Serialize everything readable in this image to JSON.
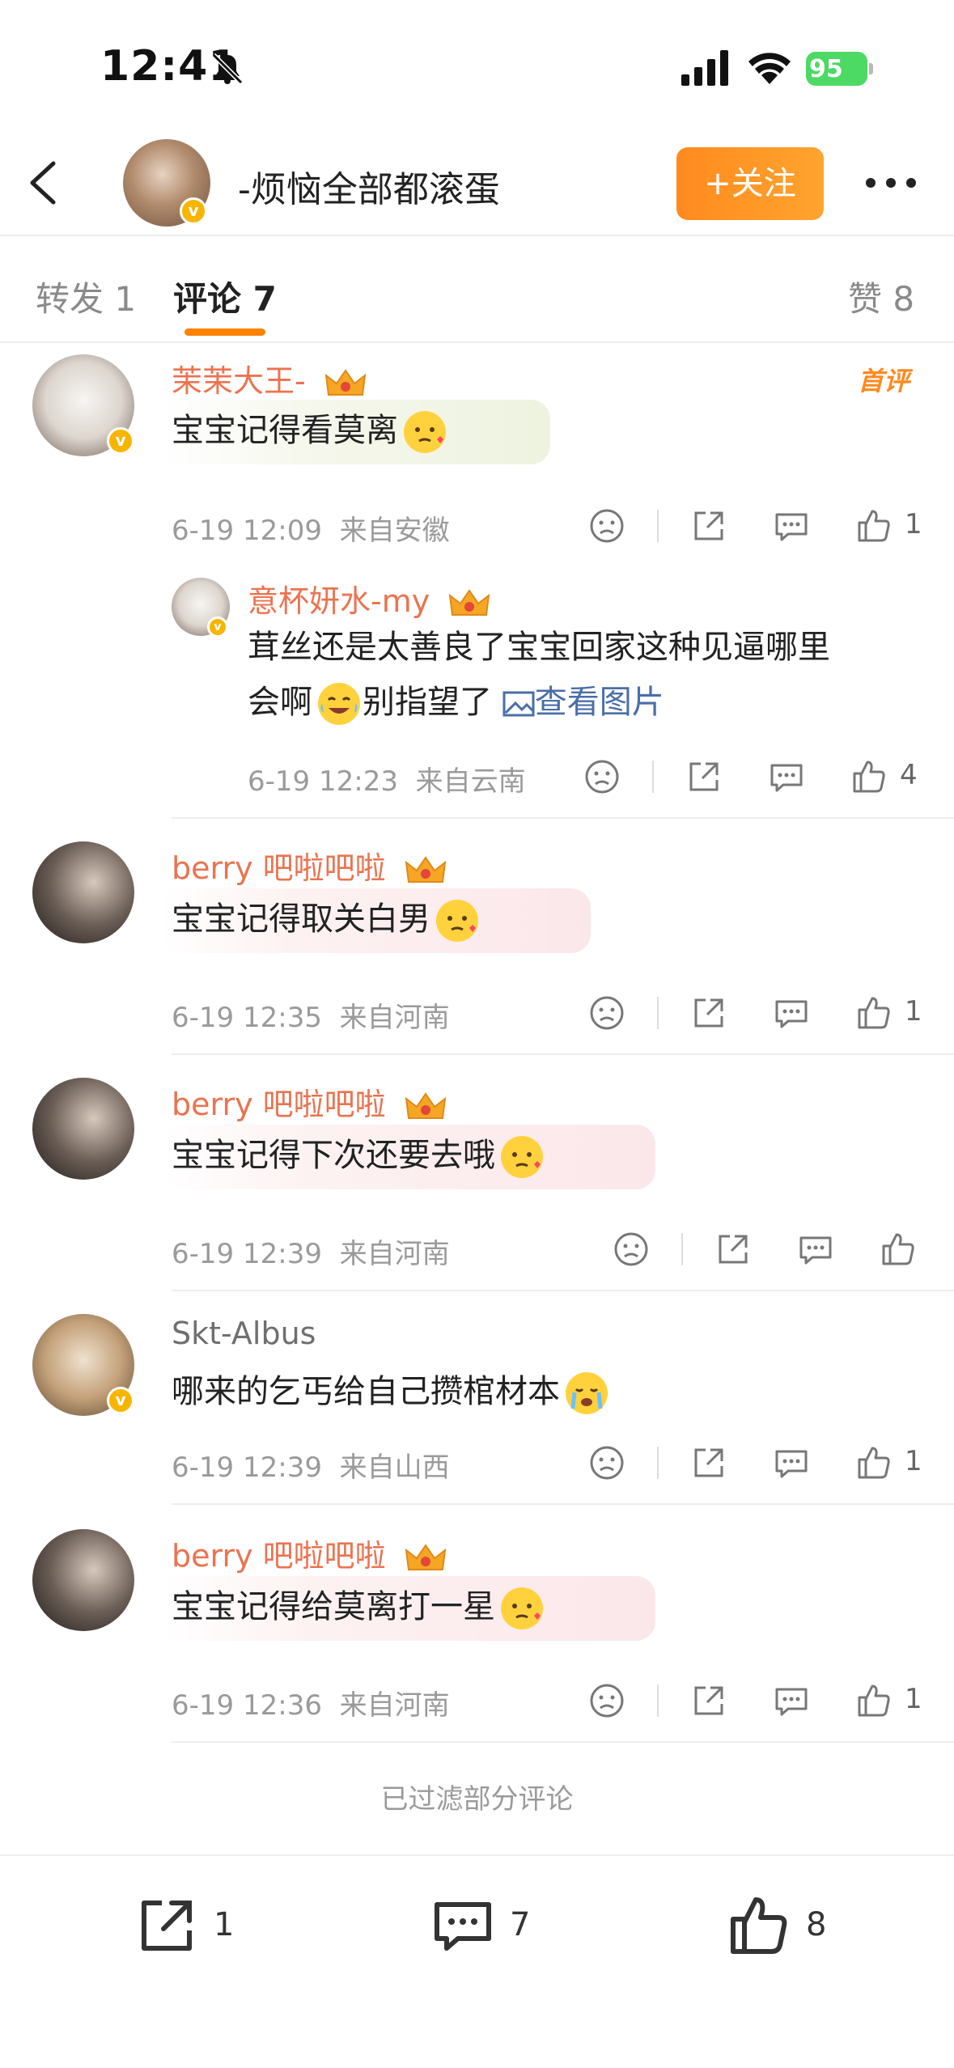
{
  "status_bar": {
    "time": "12:41",
    "battery": "95"
  },
  "header": {
    "username": "-烦恼全部都滚蛋",
    "follow_label": "+关注"
  },
  "tabs": [
    {
      "label": "转发 1"
    },
    {
      "label": "评论 7"
    },
    {
      "label": "赞 8"
    }
  ],
  "comments": [
    {
      "name": "茉茉大王-",
      "text": "宝宝记得看莫离",
      "time": "6-19 12:09",
      "location": "来自安徽",
      "likes": "1",
      "badge": "首评",
      "reply": {
        "name": "意杯妍水-my",
        "text": "茸丝还是太善良了宝宝回家这种见逼哪里",
        "text2": "会啊",
        "text3": "别指望了",
        "link": "查看图片",
        "time": "6-19 12:23",
        "location": "来自云南",
        "likes": "4"
      }
    },
    {
      "name": "berry 吧啦吧啦",
      "text": "宝宝记得取关白男",
      "time": "6-19 12:35",
      "location": "来自河南",
      "likes": "1"
    },
    {
      "name": "berry 吧啦吧啦",
      "text": "宝宝记得下次还要去哦",
      "time": "6-19 12:39",
      "location": "来自河南",
      "likes": ""
    },
    {
      "name": "Skt-Albus",
      "text": "哪来的乞丐给自己攒棺材本",
      "time": "6-19 12:39",
      "location": "来自山西",
      "likes": "1"
    },
    {
      "name": "berry 吧啦吧啦",
      "text": "宝宝记得给莫离打一星",
      "time": "6-19 12:36",
      "location": "来自河南",
      "likes": "1"
    }
  ],
  "filtered_note": "已过滤部分评论",
  "bottom_bar": {
    "repost_count": "1",
    "comment_count": "7",
    "like_count": "8"
  },
  "colors": {
    "accent": "#ff8200",
    "username": "#eb7350",
    "link": "#4a6ea8"
  }
}
